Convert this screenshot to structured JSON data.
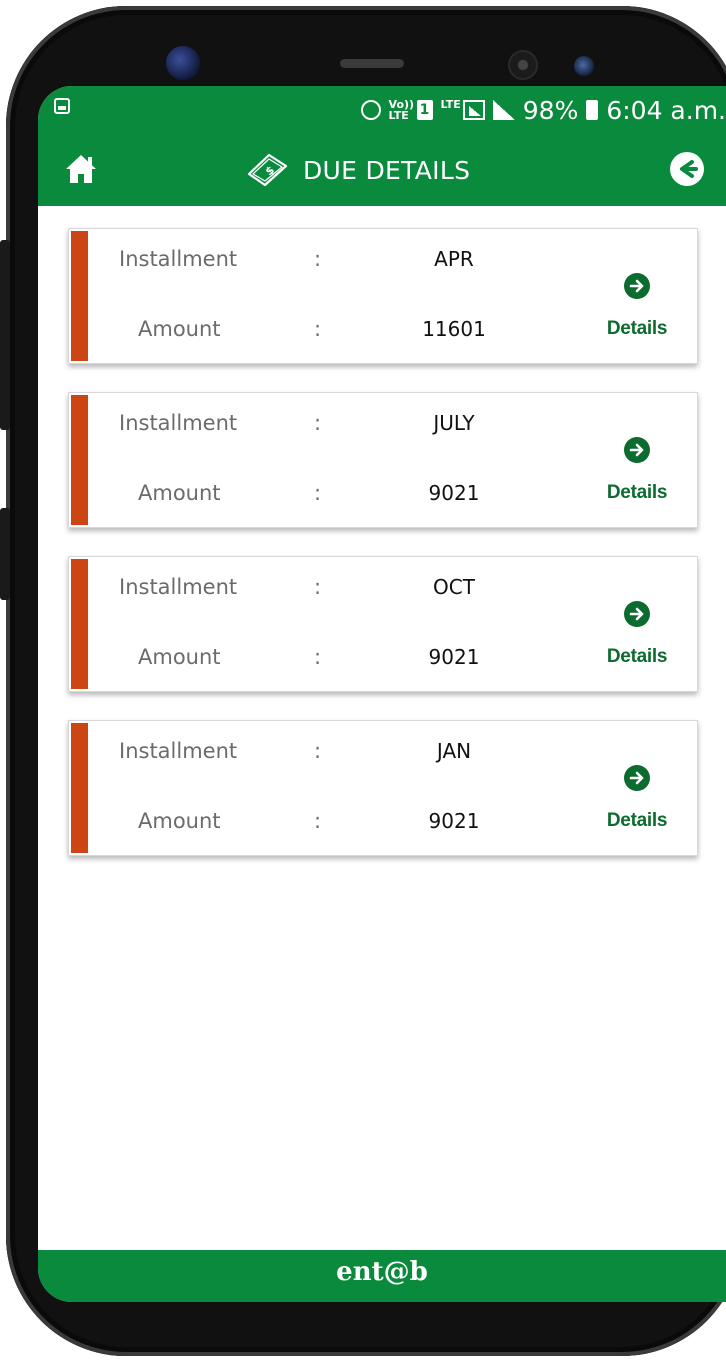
{
  "status_bar": {
    "volte": "Vo)) LTE",
    "sim_slot": "1",
    "network": "LTE",
    "battery": "98%",
    "time": "6:04 a.m."
  },
  "app_bar": {
    "title": "DUE DETAILS",
    "home_icon": "home-icon",
    "money_icon": "money-bill-icon",
    "back_icon": "arrow-left-circle-icon"
  },
  "dues": [
    {
      "installment_label": "Installment",
      "installment_sep": ":",
      "installment": "APR",
      "amount_label": "Amount",
      "amount_sep": ":",
      "amount": "11601",
      "details_label": "Details"
    },
    {
      "installment_label": "Installment",
      "installment_sep": ":",
      "installment": "JULY",
      "amount_label": "Amount",
      "amount_sep": ":",
      "amount": "9021",
      "details_label": "Details"
    },
    {
      "installment_label": "Installment",
      "installment_sep": ":",
      "installment": "OCT",
      "amount_label": "Amount",
      "amount_sep": ":",
      "amount": "9021",
      "details_label": "Details"
    },
    {
      "installment_label": "Installment",
      "installment_sep": ":",
      "installment": "JAN",
      "amount_label": "Amount",
      "amount_sep": ":",
      "amount": "9021",
      "details_label": "Details"
    }
  ],
  "footer": {
    "brand": "ent@b"
  },
  "colors": {
    "primary": "#0a8a3c",
    "accent_stripe": "#cc4514",
    "details_green": "#0c6b2e"
  }
}
